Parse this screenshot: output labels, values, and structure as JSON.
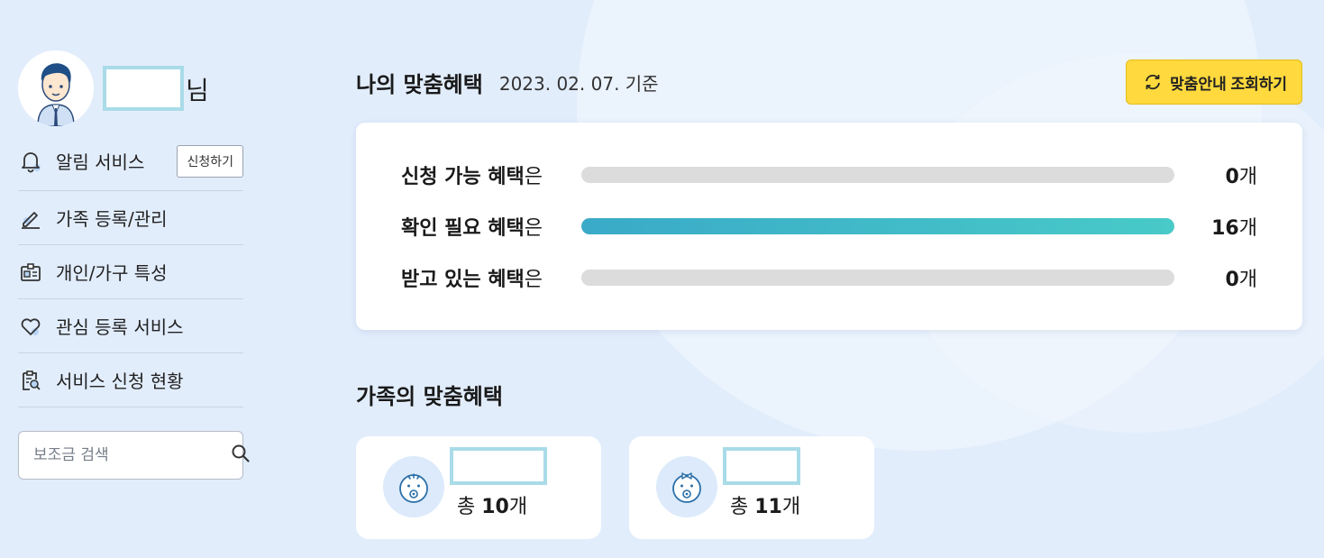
{
  "profile": {
    "name_suffix": "님"
  },
  "menu": {
    "items": [
      {
        "label": "알림 서비스",
        "icon": "bell-icon",
        "action": "신청하기"
      },
      {
        "label": "가족 등록/관리",
        "icon": "pencil-icon"
      },
      {
        "label": "개인/가구 특성",
        "icon": "id-card-icon"
      },
      {
        "label": "관심 등록 서비스",
        "icon": "heart-icon"
      },
      {
        "label": "서비스 신청 현황",
        "icon": "clipboard-search-icon"
      }
    ]
  },
  "search": {
    "placeholder": "보조금 검색",
    "icon": "search-icon"
  },
  "my_benefits": {
    "title": "나의 맞춤혜택",
    "date": "2023. 02. 07. 기준",
    "refresh_label": "맞춤안내 조회하기",
    "rows": [
      {
        "label": "신청 가능 혜택",
        "suffix": "은",
        "count": "0",
        "unit": "개",
        "fill": 0
      },
      {
        "label": "확인 필요 혜택",
        "suffix": "은",
        "count": "16",
        "unit": "개",
        "fill": 1
      },
      {
        "label": "받고 있는 혜택",
        "suffix": "은",
        "count": "0",
        "unit": "개",
        "fill": 0
      }
    ]
  },
  "family_benefits": {
    "title": "가족의 맞춤혜택",
    "members": [
      {
        "total_prefix": "총 ",
        "count": "10",
        "unit": "개",
        "icon": "baby-boy-icon"
      },
      {
        "total_prefix": "총 ",
        "count": "11",
        "unit": "개",
        "icon": "baby-girl-icon"
      }
    ]
  },
  "colors": {
    "accent_yellow": "#ffd93d",
    "bar_fill": "#3aaac8",
    "background": "#e2edfc"
  }
}
